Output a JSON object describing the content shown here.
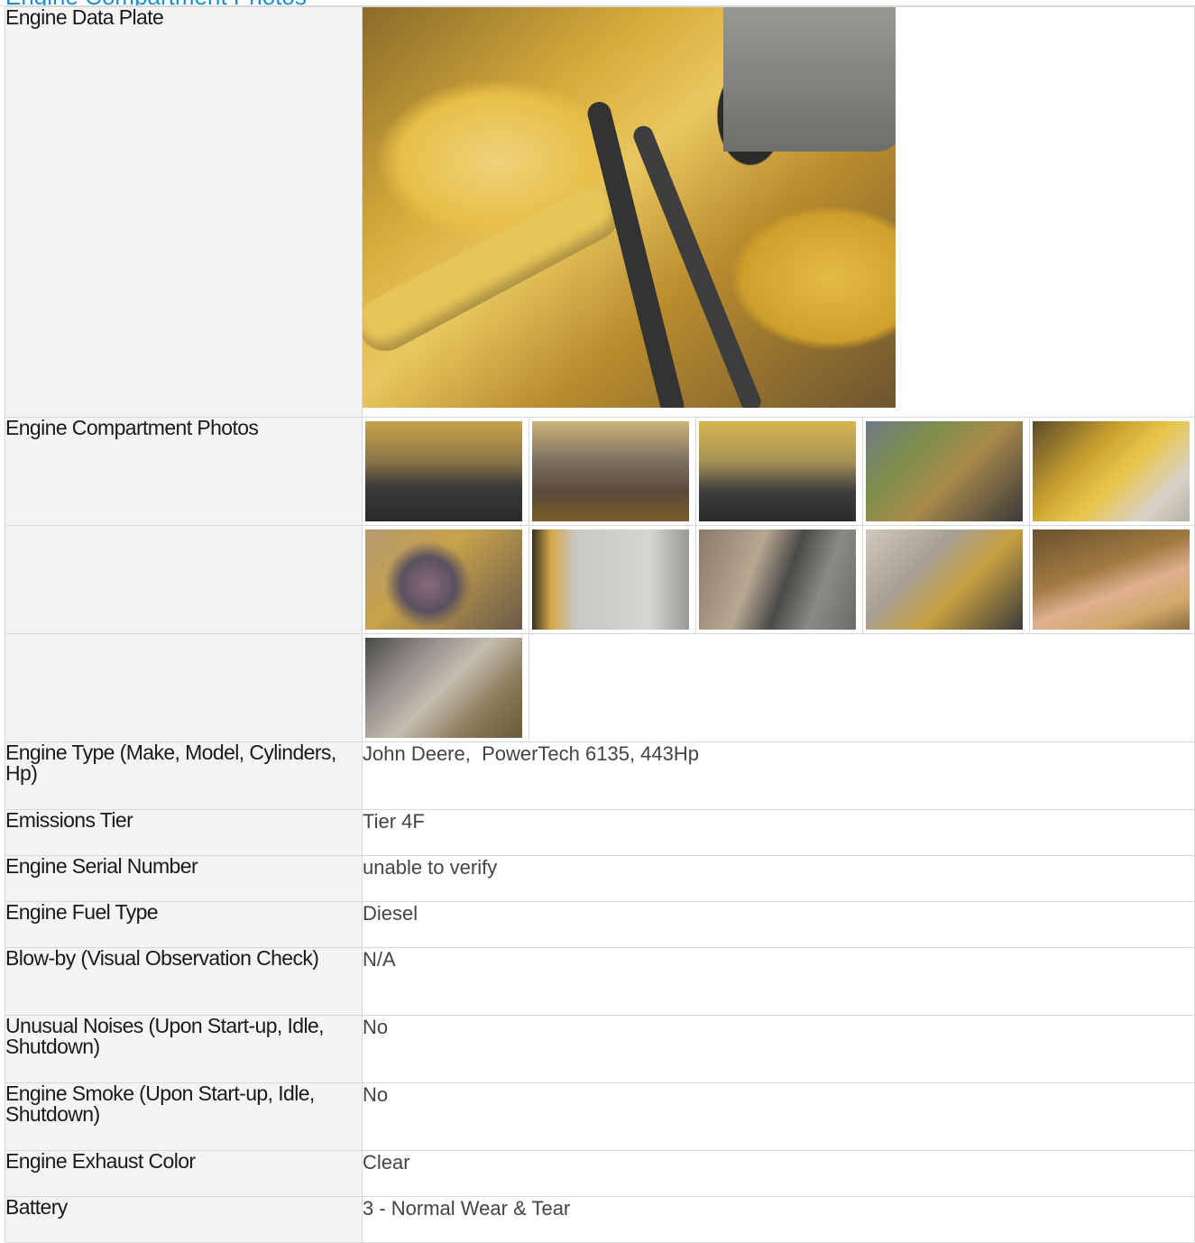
{
  "section": {
    "title": "Engine Compartment Photos"
  },
  "rows": {
    "data_plate": {
      "label": "Engine Data Plate",
      "photo": "engine-data-plate-photo"
    },
    "compartment": {
      "label": "Engine Compartment Photos",
      "thumbnails": [
        "engine-photo-1",
        "engine-photo-2",
        "engine-photo-3",
        "engine-photo-4",
        "engine-photo-5",
        "engine-photo-6",
        "engine-photo-7",
        "engine-photo-8",
        "engine-photo-9",
        "engine-photo-10",
        "engine-photo-11"
      ]
    },
    "engine_type": {
      "label": "Engine Type (Make, Model, Cylinders, Hp)",
      "value": "John Deere,  PowerTech 6135, 443Hp"
    },
    "emissions_tier": {
      "label": "Emissions Tier",
      "value": "Tier 4F"
    },
    "serial_number": {
      "label": "Engine Serial Number",
      "value": "unable to verify"
    },
    "fuel_type": {
      "label": "Engine Fuel Type",
      "value": "Diesel"
    },
    "blow_by": {
      "label": "Blow-by (Visual Observation Check)",
      "value": "N/A"
    },
    "unusual_noises": {
      "label": "Unusual Noises (Upon Start-up, Idle, Shutdown)",
      "value": "No"
    },
    "engine_smoke": {
      "label": "Engine Smoke (Upon Start-up, Idle, Shutdown)",
      "value": "No"
    },
    "exhaust_color": {
      "label": "Engine Exhaust Color",
      "value": "Clear"
    },
    "battery": {
      "label": "Battery",
      "value": "3 - Normal Wear & Tear"
    }
  },
  "colors": {
    "title_blue": "#1a8fd4",
    "label_bg": "#f4f4f4",
    "border": "#d8d8d8"
  }
}
